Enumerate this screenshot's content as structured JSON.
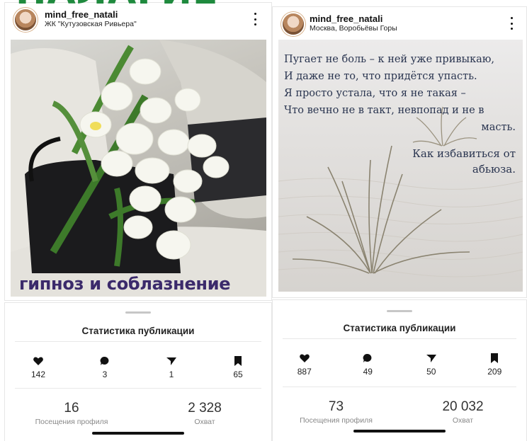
{
  "overlay": {
    "title": "НАЛАГИЕ"
  },
  "left_post": {
    "username": "mind_free_natali",
    "location": "ЖК \"Кутузовская Ривьера\"",
    "caption": "гипноз и соблазнение",
    "photo_icon": "tulips-bouquet-photo"
  },
  "right_post": {
    "username": "mind_free_natali",
    "location": "Москва, Воробьёвы Горы",
    "poem": [
      "Пугает не боль – к ней уже привыкаю,",
      "И даже не то, что придётся упасть.",
      "Я просто устала, что я не такая –",
      "Что вечно не в такт, невпопад и не в",
      "масть."
    ],
    "question": [
      "Как избавиться от",
      "абьюза."
    ],
    "photo_icon": "desert-grass-photo"
  },
  "left_stats": {
    "title": "Статистика публикации",
    "likes": "142",
    "comments": "3",
    "shares": "1",
    "saves": "65",
    "profile_visits": "16",
    "profile_visits_label": "Посещения профиля",
    "reach": "2 328",
    "reach_label": "Охват"
  },
  "right_stats": {
    "title": "Статистика публикации",
    "likes": "887",
    "comments": "49",
    "shares": "50",
    "saves": "209",
    "profile_visits": "73",
    "profile_visits_label": "Посещения профиля",
    "reach": "20 032",
    "reach_label": "Охват"
  },
  "colors": {
    "overlay_green": "#1f8a3e",
    "caption_purple": "#3b2a6b",
    "poem_ink": "#2a3550"
  }
}
